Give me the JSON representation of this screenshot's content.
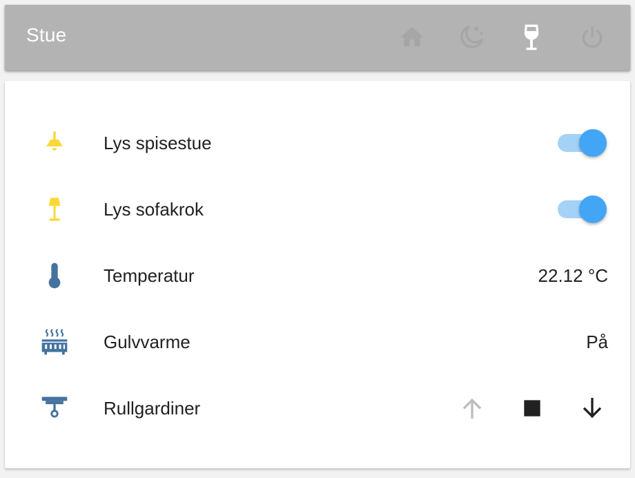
{
  "header": {
    "title": "Stue",
    "scenes": [
      {
        "icon": "home-icon",
        "active": false
      },
      {
        "icon": "night-icon",
        "active": false
      },
      {
        "icon": "wine-glass-icon",
        "active": true
      },
      {
        "icon": "power-icon",
        "active": false
      }
    ]
  },
  "rows": [
    {
      "label": "Lys spisestue",
      "icon": "ceiling-light-icon",
      "type": "toggle",
      "state": "on"
    },
    {
      "label": "Lys sofakrok",
      "icon": "floor-lamp-icon",
      "type": "toggle",
      "state": "on"
    },
    {
      "label": "Temperatur",
      "icon": "thermometer-icon",
      "type": "sensor",
      "value": "22.12 °C"
    },
    {
      "label": "Gulvvarme",
      "icon": "radiator-icon",
      "type": "sensor",
      "value": "På"
    },
    {
      "label": "Rullgardiner",
      "icon": "blinds-icon",
      "type": "cover",
      "buttons": [
        "arrow-up-icon",
        "stop-icon",
        "arrow-down-icon"
      ]
    }
  ],
  "colors": {
    "header_bg": "#b3b3b3",
    "light_on": "#fdd835",
    "entity_icon": "#44739e",
    "toggle_thumb": "#42a5f5",
    "toggle_track": "#a4d2f7",
    "inactive_scene": "#c6c6c6",
    "disabled_arrow": "#bdbdbd"
  }
}
